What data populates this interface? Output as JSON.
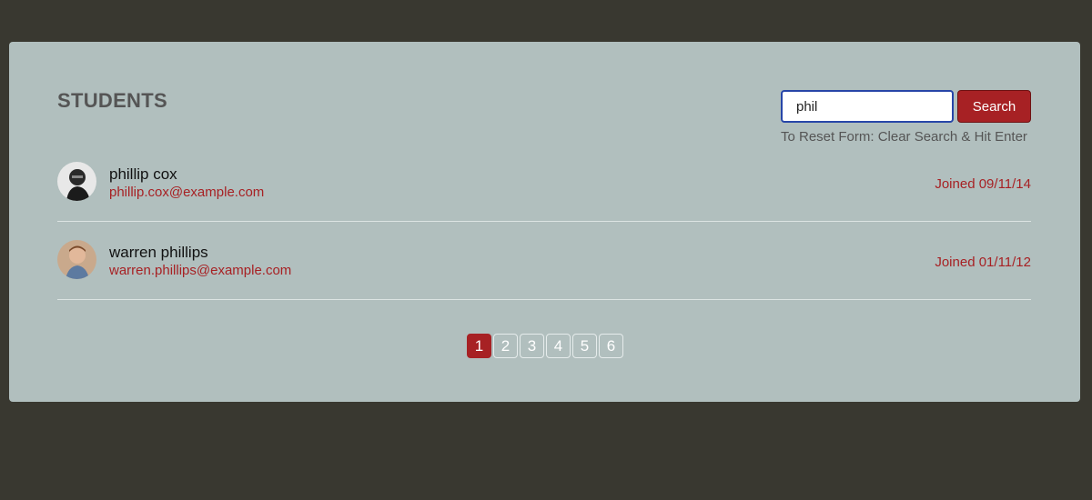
{
  "page": {
    "title": "STUDENTS"
  },
  "search": {
    "value": "phil",
    "button_label": "Search",
    "reset_hint": "To Reset Form: Clear Search & Hit Enter"
  },
  "students": [
    {
      "name": "phillip cox",
      "email": "phillip.cox@example.com",
      "joined": "Joined 09/11/14",
      "avatar_icon": "person-avatar-icon"
    },
    {
      "name": "warren phillips",
      "email": "warren.phillips@example.com",
      "joined": "Joined 01/11/12",
      "avatar_icon": "person-avatar-icon"
    }
  ],
  "pagination": {
    "pages": [
      "1",
      "2",
      "3",
      "4",
      "5",
      "6"
    ],
    "current": "1"
  },
  "colors": {
    "background": "#393830",
    "card": "#b1bfbe",
    "accent": "#a72124",
    "input_border": "#2746a8"
  }
}
